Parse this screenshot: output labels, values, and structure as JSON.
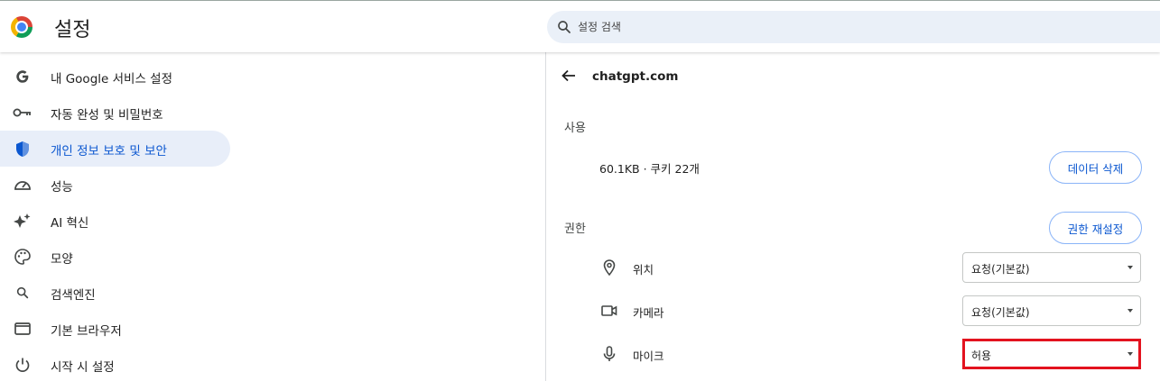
{
  "header": {
    "title": "설정",
    "search_placeholder": "설정 검색"
  },
  "sidebar": {
    "items": [
      {
        "label": "내 Google 서비스 설정",
        "icon": "google-g-icon"
      },
      {
        "label": "자동 완성 및 비밀번호",
        "icon": "key-icon"
      },
      {
        "label": "개인 정보 보호 및 보안",
        "icon": "shield-icon",
        "active": true
      },
      {
        "label": "성능",
        "icon": "speedometer-icon"
      },
      {
        "label": "AI 혁신",
        "icon": "sparkle-icon"
      },
      {
        "label": "모양",
        "icon": "palette-icon"
      },
      {
        "label": "검색엔진",
        "icon": "search-icon"
      },
      {
        "label": "기본 브라우저",
        "icon": "browser-window-icon"
      },
      {
        "label": "시작 시 설정",
        "icon": "power-icon"
      }
    ]
  },
  "site": {
    "title": "chatgpt.com",
    "usage_label": "사용",
    "usage_text": "60.1KB · 쿠키 22개",
    "delete_button": "데이터 삭제",
    "permissions_label": "권한",
    "reset_button": "권한 재설정",
    "permissions": [
      {
        "label": "위치",
        "icon": "location-pin-icon",
        "value": "요청(기본값)"
      },
      {
        "label": "카메라",
        "icon": "camera-icon",
        "value": "요청(기본값)"
      },
      {
        "label": "마이크",
        "icon": "microphone-icon",
        "value": "허용",
        "highlighted": true
      }
    ]
  },
  "colors": {
    "accent": "#0b57d0",
    "active_bg": "#e8eef9",
    "highlight_border": "#e3131f",
    "search_bg": "#eaf0f8"
  }
}
